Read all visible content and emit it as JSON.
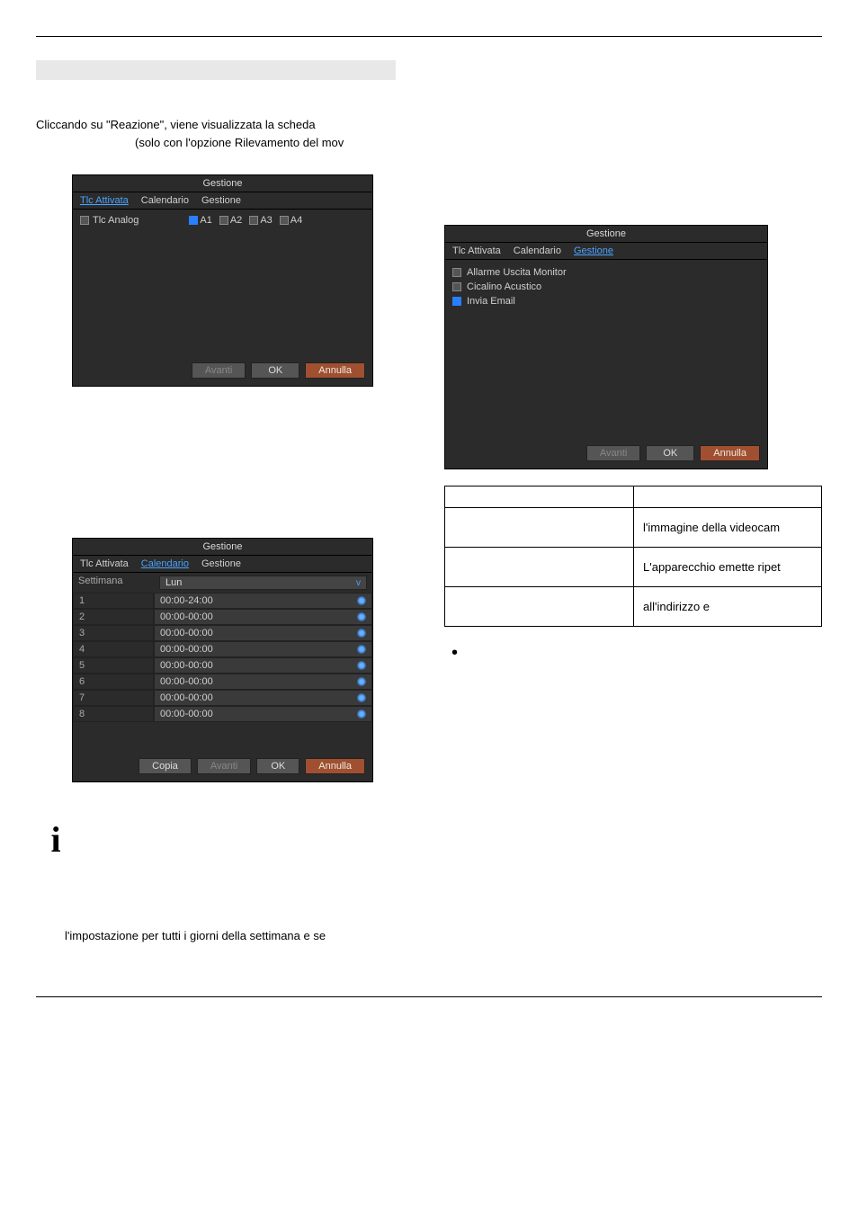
{
  "intro": {
    "line1": "Cliccando su \"Reazione\", viene visualizzata la scheda",
    "line2": "(solo con l'opzione Rilevamento del mov"
  },
  "dialog": {
    "title": "Gestione",
    "tabs": {
      "t1": "Tlc Attivata",
      "t2": "Calendario",
      "t3": "Gestione"
    },
    "buttons": {
      "copia": "Copia",
      "avanti": "Avanti",
      "ok": "OK",
      "annulla": "Annulla"
    }
  },
  "panel1": {
    "rowlabel": "Tlc Analog",
    "channels": [
      "A1",
      "A2",
      "A3",
      "A4"
    ]
  },
  "panel2": {
    "opts": [
      {
        "label": "Allarme Uscita Monitor",
        "checked": false
      },
      {
        "label": "Cicalino Acustico",
        "checked": false
      },
      {
        "label": "Invia Email",
        "checked": true
      }
    ]
  },
  "desc_table": {
    "r1c2": "l'immagine della videocam",
    "r2c2": "L'apparecchio emette ripet",
    "r3c2": "all'indirizzo e"
  },
  "schedule": {
    "col1": "Settimana",
    "day": "Lun",
    "rows": [
      {
        "n": "1",
        "t": "00:00-24:00"
      },
      {
        "n": "2",
        "t": "00:00-00:00"
      },
      {
        "n": "3",
        "t": "00:00-00:00"
      },
      {
        "n": "4",
        "t": "00:00-00:00"
      },
      {
        "n": "5",
        "t": "00:00-00:00"
      },
      {
        "n": "6",
        "t": "00:00-00:00"
      },
      {
        "n": "7",
        "t": "00:00-00:00"
      },
      {
        "n": "8",
        "t": "00:00-00:00"
      }
    ]
  },
  "info_icon": "i",
  "info_text": "l'impostazione per tutti i giorni della settimana e se"
}
